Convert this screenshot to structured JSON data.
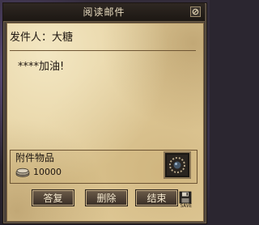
{
  "window": {
    "title": "阅读邮件"
  },
  "mail": {
    "sender_label": "发件人：",
    "sender_name": "大糖",
    "body": "****加油!"
  },
  "attachment": {
    "label": "附件物品",
    "coin_amount": "10000",
    "coin_icon": "coin-stack-icon",
    "item_icon": "item-slot-icon"
  },
  "buttons": {
    "reply": "答复",
    "delete": "删除",
    "close": "结束"
  },
  "save": {
    "label": "SAVE",
    "icon": "floppy-disk-icon"
  },
  "colors": {
    "paper": "#e4cf9d",
    "frame": "#1c1713",
    "button": "#4f4236",
    "text": "#1e1610"
  }
}
